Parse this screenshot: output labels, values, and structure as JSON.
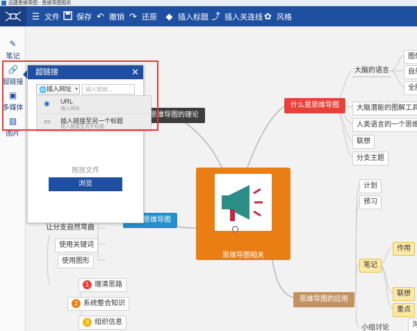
{
  "window": {
    "title": "迅捷思维导图 - 思维导图相关"
  },
  "toolbar": {
    "file": "文件",
    "save": "保存",
    "undo": "撤销",
    "redo": "还原",
    "insert_topic": "插入标题",
    "insert_relation": "插入关连线",
    "style": "风格"
  },
  "sidebar": {
    "note": "笔记",
    "hyperlink": "超链接",
    "media": "多媒体",
    "image": "图片"
  },
  "panel": {
    "title": "超链接",
    "insert_button": "插入网址",
    "input_placeholder": "输入链接...",
    "options": [
      {
        "title": "URL",
        "subtitle": "插入网址"
      },
      {
        "title": "插入链接至另一个标题",
        "subtitle": "插入链接至另外标题"
      }
    ],
    "drop_text": "拖放文件",
    "browse": "浏览"
  },
  "map": {
    "central": "思维导图相关",
    "topic_right_top": "什么是思维导图",
    "topic_left_top": "思维导图的理论",
    "topic_left_bottom": "绘制思维导图",
    "topic_right_bottom": "思维导图的应用",
    "right_top_children": [
      "大脑的语言",
      "大脑潜能的图解工具",
      "人类语言的一个思维工具",
      "联想",
      "分支主题"
    ],
    "brain_lang_children": [
      "图像",
      "自然",
      "全脑"
    ],
    "right_bottom_plain": [
      "计划",
      "预习"
    ],
    "note_node": "笔记",
    "note_children": [
      "作用",
      "联想",
      "重点"
    ],
    "group_discussion": "小组讨论",
    "discussion_child": "沟通",
    "left_bottom_children": [
      "让分支自然弯曲",
      "使用关键词",
      "使用图形"
    ],
    "numbered": [
      {
        "num": "1",
        "text": "理清思路",
        "color": "#e8413a"
      },
      {
        "num": "2",
        "text": "系统整合知识",
        "color": "#e87e14"
      },
      {
        "num": "3",
        "text": "组织信息",
        "color": "#f2b411"
      }
    ]
  }
}
